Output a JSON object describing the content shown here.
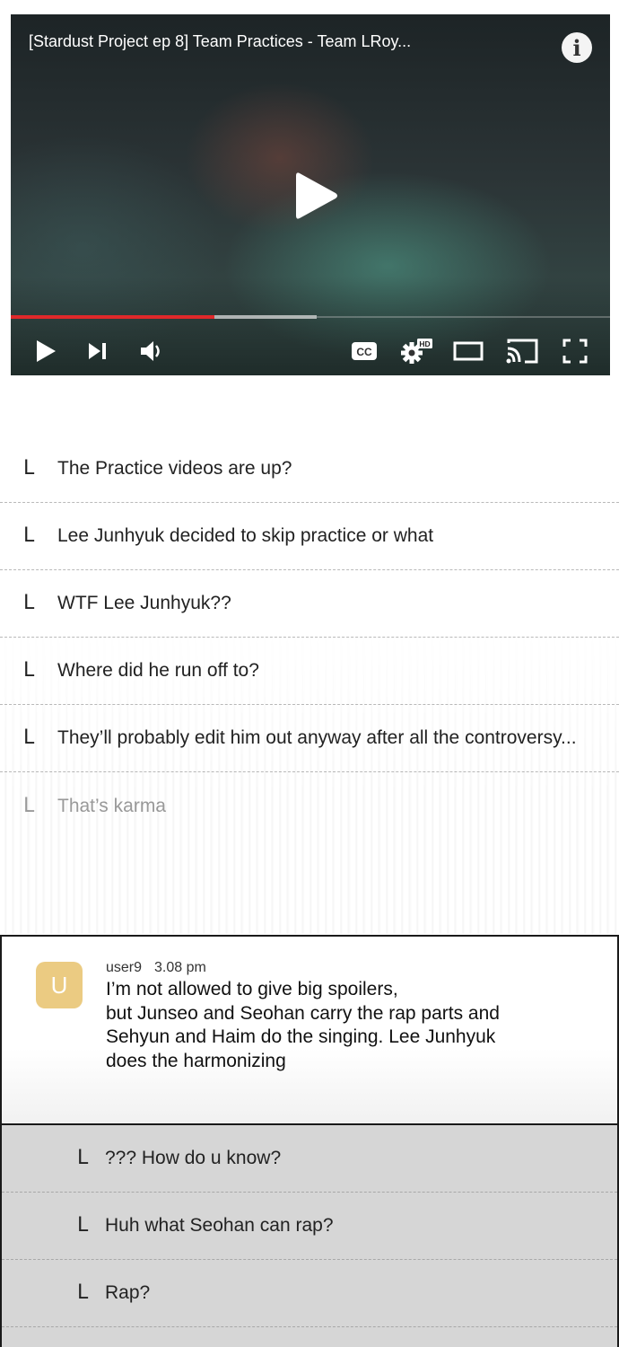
{
  "video": {
    "title": "[Stardust Project ep 8] Team Practices - Team LRoy...",
    "info_icon": "info-icon",
    "progress_played": 0.34,
    "progress_buffered": 0.51,
    "controls": [
      "play-icon",
      "next-icon",
      "volume-icon",
      "captions-icon",
      "settings-hd-icon",
      "theater-icon",
      "cast-icon",
      "fullscreen-icon"
    ],
    "hd_badge": "HD",
    "cc_label": "CC",
    "accent_color": "#e0282a"
  },
  "reply_marker": "L",
  "thread_replies": [
    {
      "text": "The Practice videos are up?"
    },
    {
      "text": "Lee Junhyuk decided to skip practice or what"
    },
    {
      "text": "WTF Lee Junhyuk??"
    },
    {
      "text": "Where did he run off to?"
    },
    {
      "text": "They’ll probably edit him out anyway after all the controversy..."
    },
    {
      "text": "That’s karma"
    }
  ],
  "comment": {
    "avatar_letter": "U",
    "avatar_color": "#ebcb82",
    "user": "user9",
    "time": "3.08 pm",
    "lines": [
      "I’m not allowed to give big spoilers,",
      "but Junseo and Seohan carry the rap parts and",
      "Sehyun and Haim do the singing. Lee Junhyuk",
      "does the harmonizing"
    ]
  },
  "nested_replies": [
    {
      "text": "??? How do u know?"
    },
    {
      "text": "Huh what Seohan can rap?"
    },
    {
      "text": "Rap?"
    }
  ]
}
